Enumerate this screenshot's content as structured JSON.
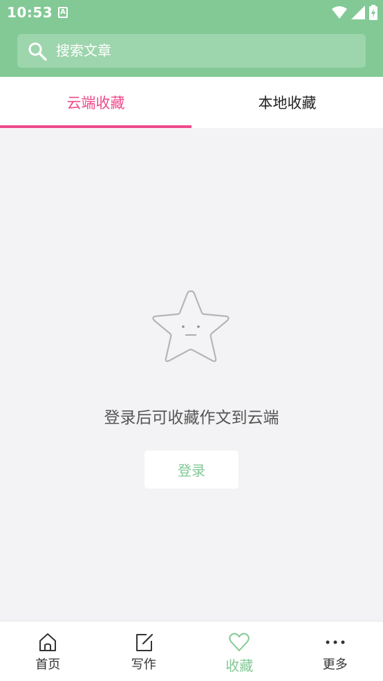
{
  "status_bar": {
    "time": "10:53",
    "notification_icon": "a-icon",
    "icons": [
      "wifi-icon",
      "signal-icon",
      "battery-icon"
    ]
  },
  "search": {
    "placeholder": "搜索文章",
    "icon": "search-icon"
  },
  "tabs": [
    {
      "label": "云端收藏",
      "active": true
    },
    {
      "label": "本地收藏",
      "active": false
    }
  ],
  "empty_state": {
    "illustration": "star-icon",
    "message": "登录后可收藏作文到云端",
    "login_button": "登录"
  },
  "bottom_nav": [
    {
      "label": "首页",
      "icon": "home-icon",
      "active": false
    },
    {
      "label": "写作",
      "icon": "edit-icon",
      "active": false
    },
    {
      "label": "收藏",
      "icon": "heart-icon",
      "active": true
    },
    {
      "label": "更多",
      "icon": "more-icon",
      "active": false
    }
  ],
  "colors": {
    "primary": "#82c995",
    "accent": "#ee4a89",
    "background": "#f3f3f5"
  }
}
